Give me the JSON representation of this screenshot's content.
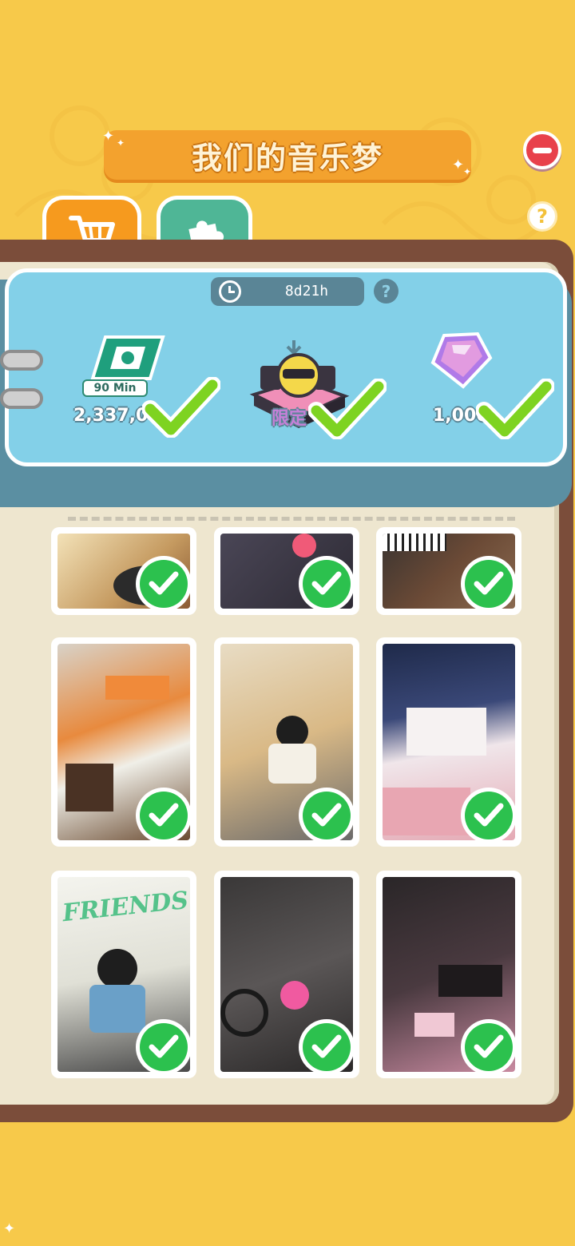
{
  "header": {
    "title": "我们的音乐梦"
  },
  "controls": {
    "close_icon": "minus-circle-icon",
    "help_label": "?"
  },
  "tabs": [
    {
      "name": "shop",
      "icon": "shopping-cart-icon",
      "active": true
    },
    {
      "name": "puzzle",
      "icon": "puzzle-piece-icon",
      "active": false
    }
  ],
  "reward_panel": {
    "timer": "8d21h",
    "timer_help_label": "?",
    "rewards": [
      {
        "icon": "green-ticket-icon",
        "tag": "90 Min",
        "label": "2,337,0",
        "claimed": true
      },
      {
        "icon": "dj-booth-icon",
        "label": "限定",
        "claimed": true
      },
      {
        "icon": "purple-gem-icon",
        "label": "1,000",
        "claimed": true
      }
    ]
  },
  "collection": {
    "cards": [
      {
        "id": "room-1",
        "theme": "cozy-guitar-room",
        "claimed": true
      },
      {
        "id": "room-2",
        "theme": "pink-stage",
        "claimed": true
      },
      {
        "id": "room-3",
        "theme": "piano-loft",
        "claimed": true
      },
      {
        "id": "room-4",
        "theme": "violin-loft",
        "claimed": true
      },
      {
        "id": "room-5",
        "theme": "violin-girl",
        "claimed": true
      },
      {
        "id": "room-6",
        "theme": "night-studio",
        "claimed": true
      },
      {
        "id": "room-7",
        "theme": "friends-band",
        "friends_text": "FRIENDS",
        "claimed": true
      },
      {
        "id": "room-8",
        "theme": "drummer-room",
        "claimed": true
      },
      {
        "id": "room-9",
        "theme": "dark-pink-room",
        "claimed": true
      }
    ]
  },
  "colors": {
    "background": "#f7c94a",
    "banner": "#f3a22e",
    "panel": "#83d0e8",
    "check": "#2cc14e",
    "big_check": "#7ed321"
  }
}
